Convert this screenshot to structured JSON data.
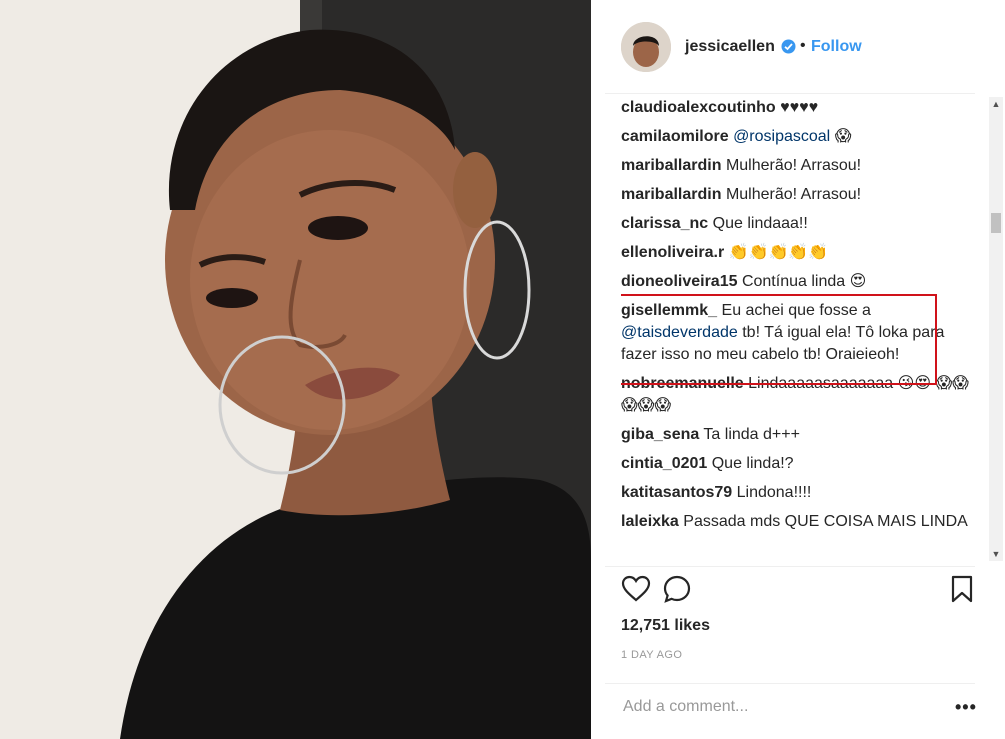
{
  "post": {
    "image_alt": "Selfie photo of woman with short hair and hoop earrings"
  },
  "header": {
    "username": "jessicaellen",
    "separator": "•",
    "follow_label": "Follow"
  },
  "comments": [
    {
      "user": "claudioalexcoutinho",
      "text": "♥♥♥♥"
    },
    {
      "user": "camilaomilore",
      "mention": "@rosipascoal",
      "text": "😱"
    },
    {
      "user": "mariballardin",
      "text": "Mulherão! Arrasou!"
    },
    {
      "user": "mariballardin",
      "text": "Mulherão! Arrasou!"
    },
    {
      "user": "clarissa_nc",
      "text": "Que lindaaa!!"
    },
    {
      "user": "ellenoliveira.r",
      "text": "👏👏👏👏👏"
    },
    {
      "user": "dioneoliveira15",
      "text": "Contínua linda 😍"
    },
    {
      "user": "gisellemmk_",
      "text": "Eu achei que fosse a",
      "mention": "@taisdeverdade",
      "text2": "tb! Tá igual ela! Tô loka para fazer isso no meu cabelo tb! Oraieieoh!"
    },
    {
      "user": "nobreemanuelle",
      "text": "Lindaaaaasaaaaaaa 😘😍 😱😱😱😱😱"
    },
    {
      "user": "giba_sena",
      "text": "Ta linda d+++"
    },
    {
      "user": "cintia_0201",
      "text": "Que linda!?"
    },
    {
      "user": "katitasantos79",
      "text": "Lindona!!!!"
    },
    {
      "user": "laleixka",
      "text": "Passada mds QUE COISA MAIS LINDA"
    }
  ],
  "actions": {
    "like_icon": "heart-icon",
    "comment_icon": "comment-bubble-icon",
    "save_icon": "bookmark-icon"
  },
  "likes_text": "12,751 likes",
  "time_ago": "1 DAY AGO",
  "comment_box": {
    "placeholder": "Add a comment...",
    "more_label": "•••"
  },
  "colors": {
    "link_blue": "#3897f0",
    "mention_blue": "#003569",
    "highlight_red": "#d0121a"
  }
}
